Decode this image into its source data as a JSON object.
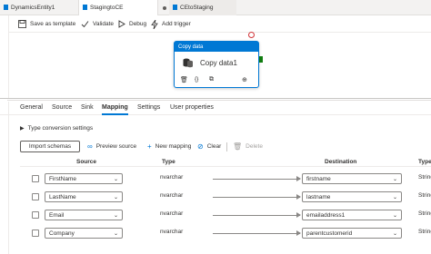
{
  "tabs": [
    {
      "label": "DynamicsEntity1",
      "active": false
    },
    {
      "label": "StagingtoCE",
      "active": true
    },
    {
      "label": "CEtoStaging",
      "active": false
    }
  ],
  "toolbar": {
    "save_template": "Save as template",
    "validate": "Validate",
    "debug": "Debug",
    "add_trigger": "Add trigger"
  },
  "activity": {
    "header": "Copy data",
    "name": "Copy data1"
  },
  "property_tabs": [
    "General",
    "Source",
    "Sink",
    "Mapping",
    "Settings",
    "User properties"
  ],
  "active_property_tab": "Mapping",
  "type_conversion": "Type conversion settings",
  "mapping_actions": {
    "import_schemas": "Import schemas",
    "preview_source": "Preview source",
    "new_mapping": "New mapping",
    "clear": "Clear",
    "delete": "Delete"
  },
  "grid": {
    "headers": {
      "source": "Source",
      "type": "Type",
      "destination": "Destination",
      "dest_type": "Type"
    },
    "rows": [
      {
        "source": "FirstName",
        "type": "nvarchar",
        "destination": "firstname",
        "dest_type": "String"
      },
      {
        "source": "LastName",
        "type": "nvarchar",
        "destination": "lastname",
        "dest_type": "String"
      },
      {
        "source": "Email",
        "type": "nvarchar",
        "destination": "emailaddress1",
        "dest_type": "String"
      },
      {
        "source": "Company",
        "type": "nvarchar",
        "destination": "parentcustomerid",
        "dest_type": "String"
      }
    ]
  },
  "colors": {
    "accent": "#0078d4",
    "success": "#107c10",
    "error": "#d13438"
  },
  "icons": [
    "tab-pipeline-icon",
    "save-icon",
    "check-icon",
    "play-icon",
    "lightning-icon",
    "expand-icon",
    "delete-icon",
    "code-icon",
    "copy-icon",
    "arrow-icon",
    "glasses-icon",
    "plus-icon",
    "clear-icon",
    "trash-icon",
    "chevron-right-icon",
    "chevron-down-icon"
  ]
}
